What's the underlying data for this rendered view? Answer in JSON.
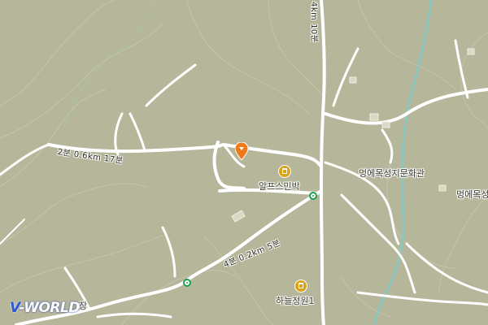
{
  "map": {
    "labels": {
      "alps_minbak": "알프스민박",
      "museum": "멍에목성지문화관",
      "museum_partial": "멍에목성",
      "haneul_garden": "하늘정원1",
      "bottom_left_partial": "장"
    },
    "route_labels": {
      "top_vertical": "4km 10분",
      "left": "2분 0.6km 17분",
      "middle": "4분 0.2km 5분"
    },
    "icons": {
      "pin": "location-pin-icon",
      "lodging": "lodging-icon",
      "bus_stop": "bus-stop-icon"
    },
    "logo": {
      "prefix": "V",
      "text": "-WORLD"
    },
    "colors": {
      "terrain": "#b6b69b",
      "road": "#ffffff",
      "contour": "#c6c6ad",
      "stream": "#86c9c4",
      "pin": "#f07a1a",
      "station": "#1aa34a"
    }
  }
}
